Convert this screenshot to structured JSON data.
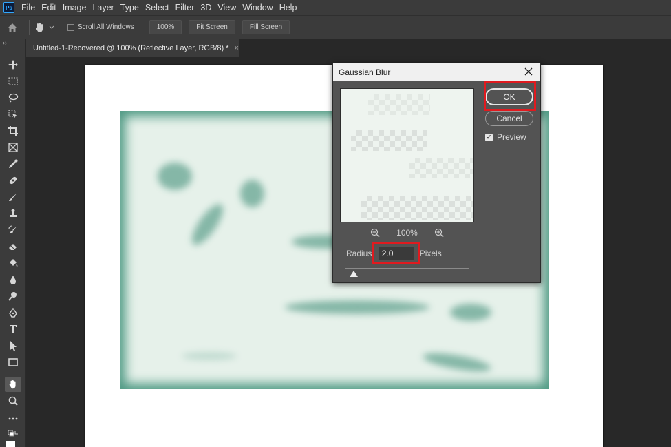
{
  "app": {
    "logo": "Ps"
  },
  "menu": [
    "File",
    "Edit",
    "Image",
    "Layer",
    "Type",
    "Select",
    "Filter",
    "3D",
    "View",
    "Window",
    "Help"
  ],
  "options": {
    "scroll_all_windows": "Scroll All Windows",
    "zoom_100": "100%",
    "fit_screen": "Fit Screen",
    "fill_screen": "Fill Screen"
  },
  "tab": {
    "title": "Untitled-1-Recovered @ 100% (Reflective Layer, RGB/8) *",
    "close": "×"
  },
  "toolbar": {
    "collapse": "››"
  },
  "dialog": {
    "title": "Gaussian Blur",
    "zoom": "100%",
    "ok": "OK",
    "cancel": "Cancel",
    "preview_label": "Preview",
    "preview_checked": true,
    "radius_label": "Radius:",
    "radius_value": "2.0",
    "units": "Pixels",
    "slider_fraction": 0.07
  },
  "colors": {
    "highlight": "#e01a1f",
    "art_edge": "#4f9a84",
    "art_fill": "#e6f1ea"
  }
}
